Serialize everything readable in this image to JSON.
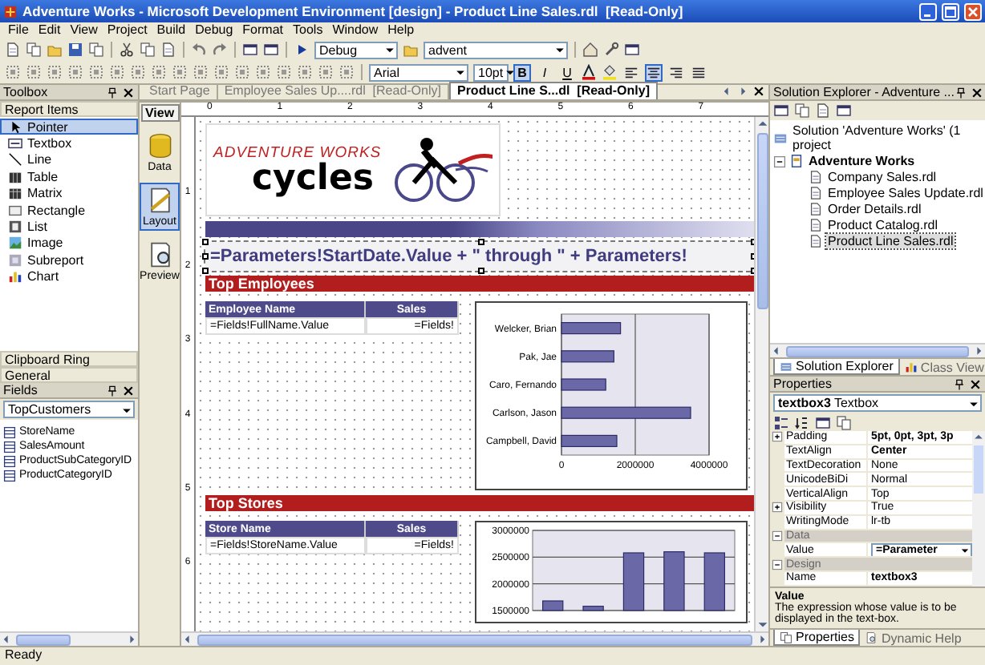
{
  "window": {
    "title": "Adventure Works - Microsoft Development Environment [design] - Product Line Sales.rdl  [Read-Only]"
  },
  "menu": [
    "File",
    "Edit",
    "View",
    "Project",
    "Build",
    "Debug",
    "Format",
    "Tools",
    "Window",
    "Help"
  ],
  "toolbar": {
    "configuration": "Debug",
    "project": "advent"
  },
  "format_toolbar": {
    "font": "Arial",
    "size": "10pt",
    "styles": [
      {
        "label": "B",
        "pressed": true
      },
      {
        "label": "I",
        "pressed": false
      },
      {
        "label": "U",
        "pressed": false
      }
    ],
    "alignments": [
      {
        "kind": "left",
        "pressed": false
      },
      {
        "kind": "center",
        "pressed": true
      },
      {
        "kind": "right",
        "pressed": false
      },
      {
        "kind": "justify",
        "pressed": false
      }
    ]
  },
  "toolbox": {
    "title": "Toolbox",
    "section": "Report Items",
    "items": [
      {
        "kind": "pointer",
        "label": "Pointer",
        "selected": true
      },
      {
        "kind": "textbox",
        "label": "Textbox",
        "selected": false
      },
      {
        "kind": "line",
        "label": "Line",
        "selected": false
      },
      {
        "kind": "table",
        "label": "Table",
        "selected": false
      },
      {
        "kind": "matrix",
        "label": "Matrix",
        "selected": false
      },
      {
        "kind": "rectangle",
        "label": "Rectangle",
        "selected": false
      },
      {
        "kind": "list",
        "label": "List",
        "selected": false
      },
      {
        "kind": "image",
        "label": "Image",
        "selected": false
      },
      {
        "kind": "subreport",
        "label": "Subreport",
        "selected": false
      },
      {
        "kind": "chart",
        "label": "Chart",
        "selected": false
      }
    ],
    "other_sections": [
      "Clipboard Ring",
      "General"
    ]
  },
  "fields": {
    "title": "Fields",
    "dataset": "TopCustomers",
    "items": [
      "StoreName",
      "SalesAmount",
      "ProductSubCategoryID",
      "ProductCategoryID"
    ]
  },
  "document_tabs": [
    {
      "label": "Start Page",
      "selected": false
    },
    {
      "label": "Employee Sales Up....rdl  [Read-Only]",
      "selected": false
    },
    {
      "label": "Product Line S...dl  [Read-Only]",
      "selected": true
    }
  ],
  "view_bar": {
    "title": "View",
    "items": [
      {
        "kind": "data",
        "label": "Data",
        "selected": false
      },
      {
        "kind": "layout",
        "label": "Layout",
        "selected": true
      },
      {
        "kind": "preview",
        "label": "Preview",
        "selected": false
      }
    ]
  },
  "ruler": {
    "horizontal": [
      "0",
      "1",
      "2",
      "3",
      "4",
      "5",
      "6",
      "7"
    ],
    "vertical": [
      "1",
      "2",
      "3",
      "4",
      "5",
      "6"
    ]
  },
  "report": {
    "logo": {
      "line_1": "ADVENTURE WORKS",
      "line_2": "cycles"
    },
    "expression": {
      "text": "=Parameters!StartDate.Value + \" through \" + Parameters!",
      "selected": true
    },
    "sections": [
      {
        "title": "Top Employees",
        "table": {
          "columns": [
            "Employee Name",
            "Sales"
          ],
          "row": [
            "=Fields!FullName.Value",
            "=Fields!"
          ]
        },
        "chart_data": {
          "type": "bar",
          "orientation": "horizontal",
          "categories": [
            "Welcker, Brian",
            "Pak, Jae",
            "Caro, Fernando",
            "Carlson, Jason",
            "Campbell, David"
          ],
          "values": [
            1600000,
            1420000,
            1200000,
            3500000,
            1500000
          ],
          "xlim": [
            0,
            4000000
          ],
          "xticks": [
            0,
            2000000,
            4000000
          ]
        }
      },
      {
        "title": "Top Stores",
        "table": {
          "columns": [
            "Store Name",
            "Sales"
          ],
          "row": [
            "=Fields!StoreName.Value",
            "=Fields!"
          ]
        },
        "chart_data": {
          "type": "bar",
          "values": [
            1680000,
            1580000,
            2580000,
            2600000,
            2580000
          ],
          "ylim": [
            1500000,
            3000000
          ],
          "yticks": [
            1500000,
            2000000,
            2500000,
            3000000
          ]
        }
      }
    ]
  },
  "solution_explorer": {
    "title": "Solution Explorer - Adventure ...",
    "solution": "Solution 'Adventure Works' (1 project",
    "project": {
      "label": "Adventure Works",
      "expanded": true,
      "children": [
        {
          "label": "Company Sales.rdl",
          "selected": false
        },
        {
          "label": "Employee Sales Update.rdl",
          "selected": false
        },
        {
          "label": "Order Details.rdl",
          "selected": false
        },
        {
          "label": "Product Catalog.rdl",
          "selected": false
        },
        {
          "label": "Product Line Sales.rdl",
          "selected": true
        }
      ]
    },
    "tabs": [
      {
        "label": "Solution Explorer",
        "selected": true
      },
      {
        "label": "Class View",
        "selected": false
      }
    ]
  },
  "properties": {
    "title": "Properties",
    "object": "textbox3",
    "type": "Textbox",
    "rows": [
      {
        "kind": "property",
        "name": "Padding",
        "value": "5pt, 0pt, 3pt, 3p",
        "bold": true,
        "expandable": true
      },
      {
        "kind": "property",
        "name": "TextAlign",
        "value": "Center",
        "bold": true,
        "expandable": false
      },
      {
        "kind": "property",
        "name": "TextDecoration",
        "value": "None",
        "bold": false,
        "expandable": false
      },
      {
        "kind": "property",
        "name": "UnicodeBiDi",
        "value": "Normal",
        "bold": false,
        "expandable": false
      },
      {
        "kind": "property",
        "name": "VerticalAlign",
        "value": "Top",
        "bold": false,
        "expandable": false
      },
      {
        "kind": "property",
        "name": "Visibility",
        "value": "True",
        "bold": false,
        "expandable": true
      },
      {
        "kind": "property",
        "name": "WritingMode",
        "value": "lr-tb",
        "bold": false,
        "expandable": false
      },
      {
        "kind": "category",
        "name": "Data",
        "expanded": true
      },
      {
        "kind": "dropdown",
        "name": "Value",
        "value": "=Parameter",
        "bold": true,
        "expandable": false
      },
      {
        "kind": "category",
        "name": "Design",
        "expanded": true
      },
      {
        "kind": "property",
        "name": "Name",
        "value": "textbox3",
        "bold": true,
        "expandable": false
      }
    ],
    "description": {
      "title": "Value",
      "text": "The expression whose value is to be displayed in the text-box."
    },
    "tabs": [
      {
        "label": "Properties",
        "selected": true
      },
      {
        "label": "Dynamic Help",
        "selected": false
      }
    ]
  },
  "status_bar": "Ready"
}
